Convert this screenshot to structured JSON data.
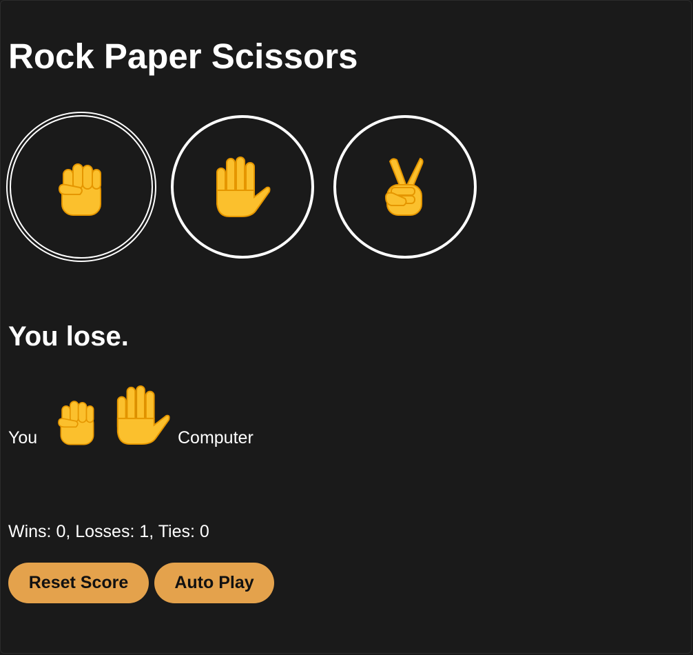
{
  "page": {
    "title": "Rock Paper Scissors"
  },
  "moves": {
    "rock": {
      "icon": "raised-fist-icon",
      "label": "Rock"
    },
    "paper": {
      "icon": "raised-hand-icon",
      "label": "Paper"
    },
    "scissors": {
      "icon": "victory-hand-icon",
      "label": "Scissors"
    }
  },
  "result": {
    "text": "You lose.",
    "you_label": "You",
    "computer_label": "Computer",
    "player_move_icon": "raised-fist-icon",
    "computer_move_icon": "raised-hand-icon"
  },
  "score": {
    "text": "Wins: 0, Losses: 1, Ties: 0",
    "wins": 0,
    "losses": 1,
    "ties": 0
  },
  "actions": {
    "reset_label": "Reset Score",
    "auto_play_label": "Auto Play"
  },
  "colors": {
    "background": "#1a1a1a",
    "button_accent": "#e4a24c",
    "emoji_yellow": "#fbc02d",
    "emoji_shade": "#e59600"
  }
}
